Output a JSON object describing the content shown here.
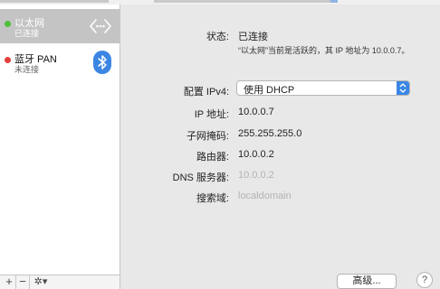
{
  "sidebar": {
    "services": [
      {
        "name": "以太网",
        "status": "已连接",
        "status_color": "#4fbf3b"
      },
      {
        "name": "蓝牙 PAN",
        "status": "未连接",
        "status_color": "#e4403a"
      }
    ],
    "buttons": {
      "add": "+",
      "remove": "−",
      "gear": "✲▾"
    }
  },
  "detail": {
    "status_label": "状态:",
    "status_value": "已连接",
    "status_note": "“以太网”当前是活跃的，其 IP 地址为 10.0.0.7。",
    "configure_label": "配置 IPv4:",
    "configure_value": "使用 DHCP",
    "ip_label": "IP 地址:",
    "ip_value": "10.0.0.7",
    "mask_label": "子网掩码:",
    "mask_value": "255.255.255.0",
    "router_label": "路由器:",
    "router_value": "10.0.0.2",
    "dns_label": "DNS 服务器:",
    "dns_value": "10.0.0.2",
    "search_label": "搜索域:",
    "search_value": "localdomain"
  },
  "footer": {
    "advanced": "高级...",
    "help": "?"
  },
  "colors": {
    "accent": "#3b86e3",
    "selection": "#c4c4c4"
  }
}
